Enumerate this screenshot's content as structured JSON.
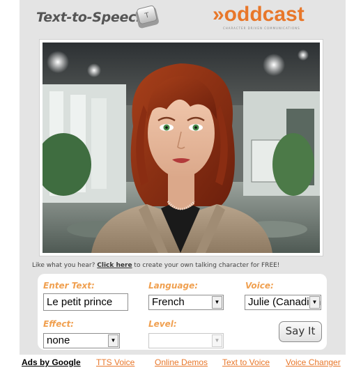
{
  "header": {
    "title": "Text-to-Speech",
    "key_icon_letter": "T",
    "logo_text": "»oddcast",
    "logo_tagline": "CHARACTER DRIVEN COMMUNICATIONS"
  },
  "promo": {
    "before": "Like what you hear? ",
    "link": "Click here",
    "after": " to create your own talking character for FREE!"
  },
  "form": {
    "enter_text_label": "Enter Text:",
    "enter_text_value": "Le petit prince",
    "language_label": "Language:",
    "language_value": "French",
    "voice_label": "Voice:",
    "voice_value": "Julie (Canadian)",
    "effect_label": "Effect:",
    "effect_value": "none",
    "level_label": "Level:",
    "level_value": "",
    "say_button": "Say It"
  },
  "footer": {
    "ads": "Ads by Google",
    "links": [
      "TTS Voice",
      "Online Demos",
      "Text to Voice",
      "Voice Changer"
    ]
  },
  "colors": {
    "accent": "#e8772a",
    "label": "#f0a050",
    "panel": "#e4e4e4"
  },
  "icons": {
    "key": "keyboard-key-icon",
    "dropdown": "chevron-down-icon"
  }
}
